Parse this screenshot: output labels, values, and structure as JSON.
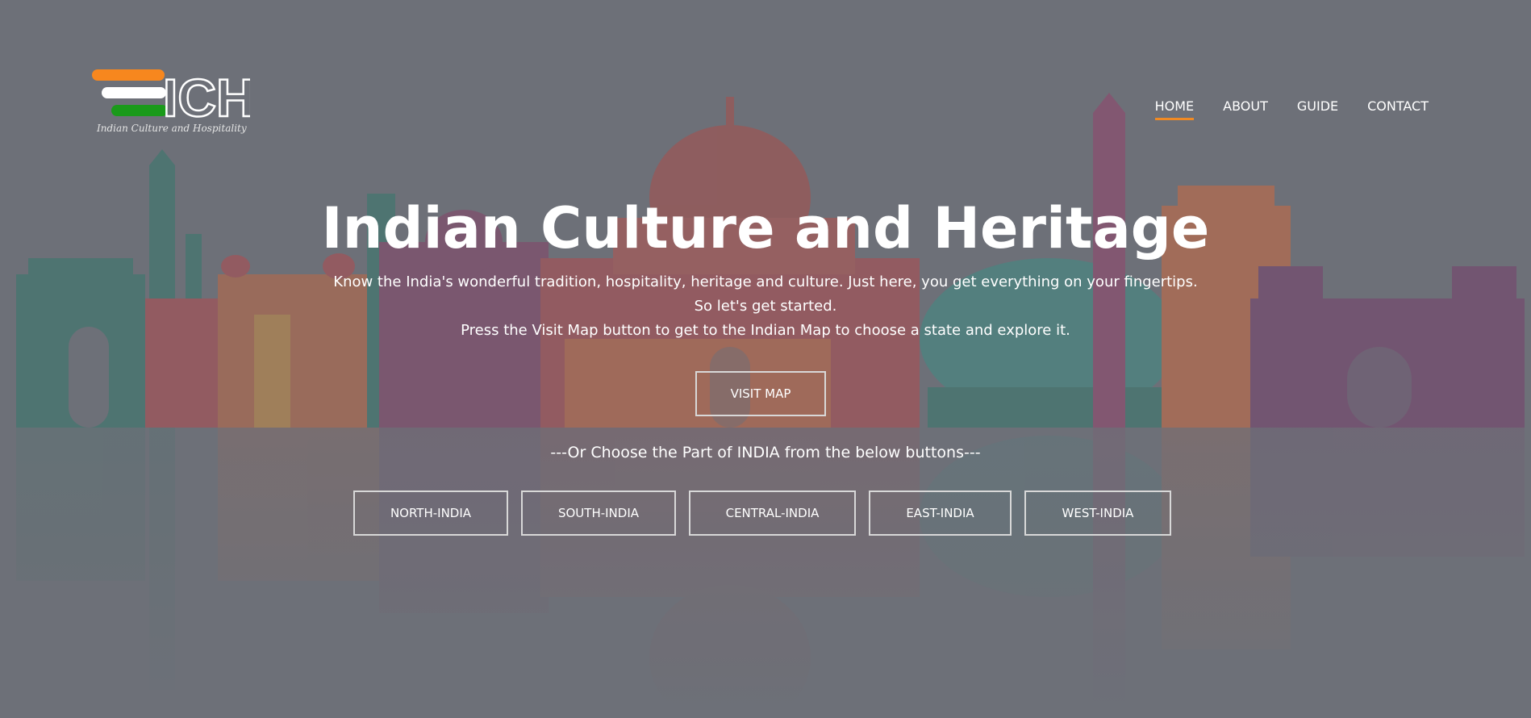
{
  "logo": {
    "letters": "ICH",
    "tagline": "Indian Culture and Hospitality",
    "flag_colors": [
      "#f7871e",
      "#ffffff",
      "#1a9a1a"
    ]
  },
  "nav": {
    "items": [
      {
        "label": "HOME",
        "active": true
      },
      {
        "label": "ABOUT",
        "active": false
      },
      {
        "label": "GUIDE",
        "active": false
      },
      {
        "label": "CONTACT",
        "active": false
      }
    ],
    "active_underline_color": "#f08a24"
  },
  "hero": {
    "title": "Indian Culture and Heritage",
    "line1": "Know the India's wonderful tradition, hospitality, heritage and culture. Just here, you get everything on your fingertips.",
    "line2": "So let's get started.",
    "line3": "Press the Visit Map button to get to the Indian Map to choose a state and explore it."
  },
  "visit_button": {
    "label": "VISIT MAP"
  },
  "or_text": "---Or Choose the Part of INDIA from the below buttons---",
  "regions": [
    {
      "label": "NORTH-INDIA"
    },
    {
      "label": "SOUTH-INDIA"
    },
    {
      "label": "CENTRAL-INDIA"
    },
    {
      "label": "EAST-INDIA"
    },
    {
      "label": "WEST-INDIA"
    }
  ],
  "background": {
    "overlay_color": "#6d7078",
    "skyline_colors": [
      "#2f7a6a",
      "#c0504a",
      "#d9833a",
      "#9a3e6a",
      "#3a8f86",
      "#7a3a6a"
    ]
  }
}
